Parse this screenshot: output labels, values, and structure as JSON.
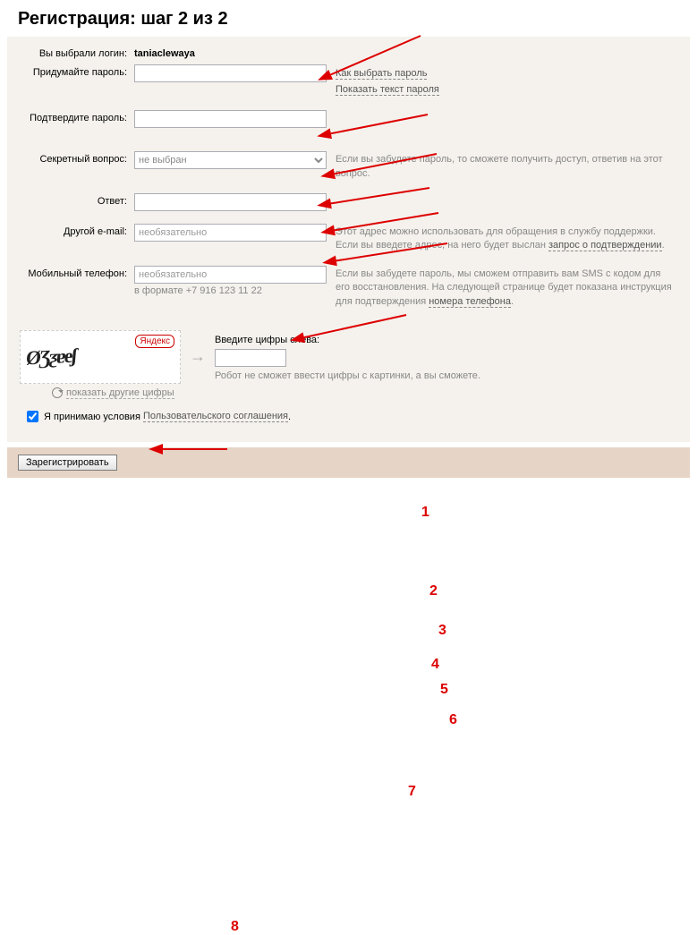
{
  "title": "Регистрация: шаг 2 из 2",
  "login_label": "Вы выбрали логин:",
  "login_value": "taniaclewaya",
  "pwd_label": "Придумайте пароль:",
  "pwd_hint1": "Как выбрать пароль",
  "pwd_hint2": "Показать текст пароля",
  "pwd2_label": "Подтвердите пароль:",
  "secret_label": "Секретный вопрос:",
  "secret_selected": "не выбран",
  "secret_hint": "Если вы забудете пароль, то сможете получить доступ, ответив на этот вопрос.",
  "answer_label": "Ответ:",
  "email_label": "Другой e-mail:",
  "email_placeholder": "необязательно",
  "email_hint_a": "Этот адрес можно использовать для обращения в службу поддержки. Если вы введете адрес, на него будет выслан ",
  "email_hint_link": "запрос о подтверждении",
  "phone_label": "Мобильный телефон:",
  "phone_placeholder": "необязательно",
  "phone_format": "в формате +7 916 123 11 22",
  "phone_hint_a": "Если вы забудете пароль, мы сможем отправить вам SMS с кодом для его восстановления. На следующей странице будет показана инструкция для подтверждения ",
  "phone_hint_link": "номера телефона",
  "captcha_brand": "Яндекс",
  "captcha_label": "Введите цифры слева:",
  "captcha_note": "Робот не сможет ввести цифры с картинки, а вы сможете.",
  "captcha_refresh": "показать другие цифры",
  "agree_a": "Я принимаю условия ",
  "agree_link": "Пользовательского соглашения",
  "submit": "Зарегистрировать",
  "annotations": {
    "1": "1",
    "2": "2",
    "3": "3",
    "4": "4",
    "5": "5",
    "6": "6",
    "7": "7",
    "8": "8"
  }
}
